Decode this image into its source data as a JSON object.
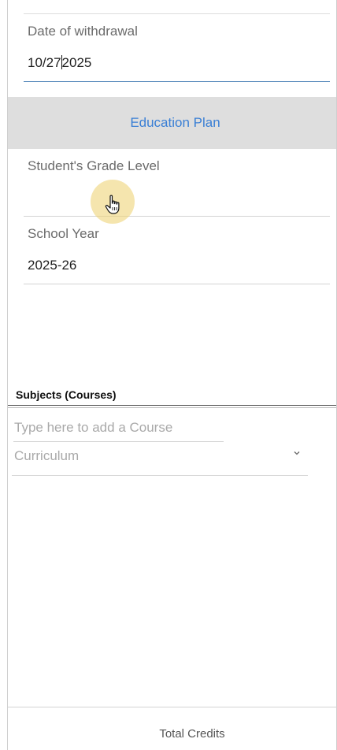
{
  "withdrawal": {
    "label": "Date of withdrawal",
    "value_before_caret": "10/27",
    "value_after_caret": "2025"
  },
  "section": {
    "title": "Education Plan"
  },
  "grade_level": {
    "label": "Student's Grade Level",
    "value": ""
  },
  "school_year": {
    "label": "School Year",
    "value": "2025-26"
  },
  "subjects": {
    "title": "Subjects (Courses)",
    "course_placeholder": "Type here to add a Course",
    "curriculum_placeholder": "Curriculum"
  },
  "footer": {
    "total_credits_label": "Total Credits"
  },
  "icons": {
    "cursor": "hand-pointer-icon",
    "dropdown": "chevron-down-icon"
  },
  "colors": {
    "accent_link": "#3a7fd5",
    "active_underline": "#5f8fbf",
    "section_bg": "#dedede"
  }
}
